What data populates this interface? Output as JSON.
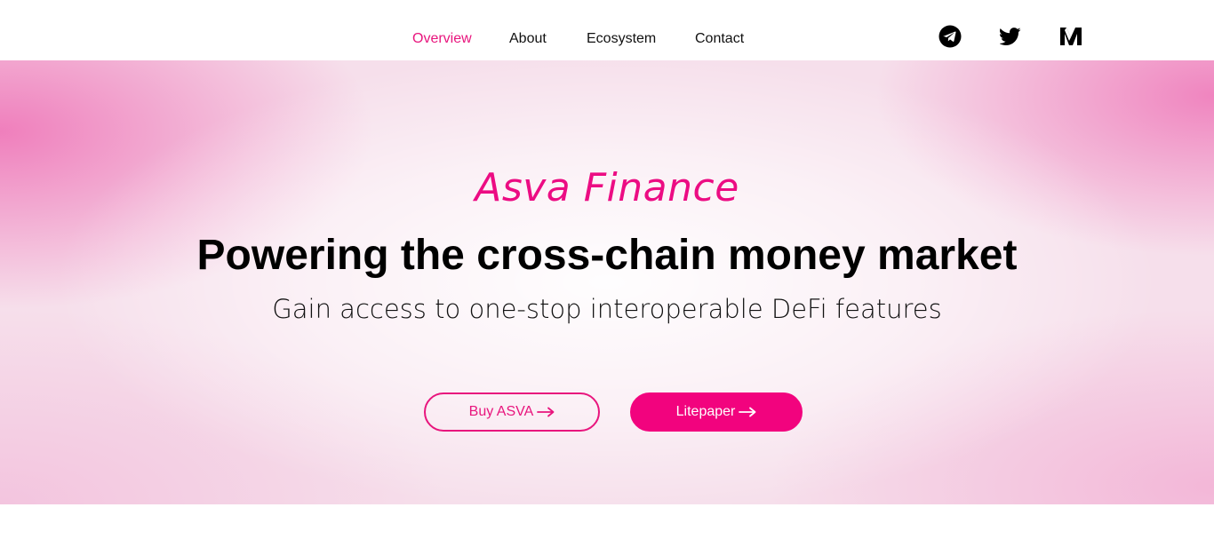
{
  "nav": {
    "items": [
      {
        "label": "Overview",
        "active": true
      },
      {
        "label": "About",
        "active": false
      },
      {
        "label": "Ecosystem",
        "active": false
      },
      {
        "label": "Contact",
        "active": false
      }
    ]
  },
  "social": [
    "telegram-icon",
    "twitter-icon",
    "medium-icon"
  ],
  "hero": {
    "brand": "Asva Finance",
    "headline": "Powering the cross-chain money market",
    "subline": "Gain access to one-stop interoperable DeFi features"
  },
  "buttons": {
    "buy_label": "Buy ASVA",
    "litepaper_label": "Litepaper"
  },
  "colors": {
    "accent": "#e8157d",
    "button_fill": "#f2037e",
    "text": "#000000"
  }
}
